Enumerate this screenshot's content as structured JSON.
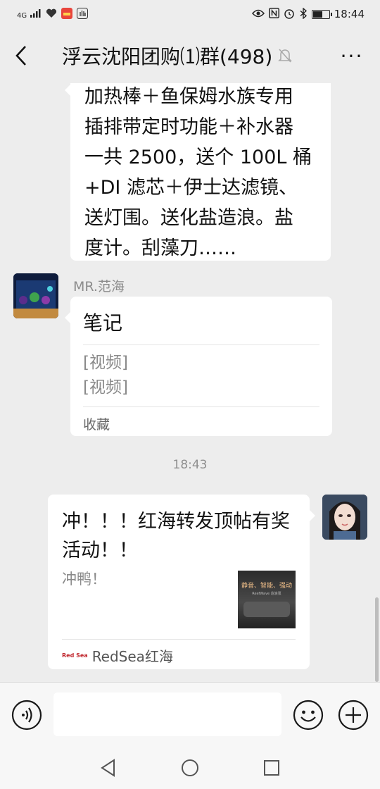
{
  "status_bar": {
    "network": "4G",
    "time": "18:44"
  },
  "header": {
    "title": "浮云沈阳团购⑴群(498)",
    "back_icon": "chevron-left-icon",
    "mute_icon": "bell-off-icon",
    "more_label": "···"
  },
  "messages": {
    "msg1": {
      "lines": [
        "加热棒＋鱼保姆水族专用",
        "插排带定时功能＋补水器",
        "一共 2500，送个 100L 桶",
        "+DI 滤芯＋伊士达滤镜、",
        "送灯围。送化盐造浪。盐",
        "度计。刮藻刀……"
      ]
    },
    "msg2": {
      "sender": "MR.范海",
      "note_title": "笔记",
      "items": [
        "[视频]",
        "[视频]"
      ],
      "footer": "收藏"
    },
    "timestamp": "18:43",
    "msg3": {
      "title": "冲！！！红海转发顶帖有奖活动！！",
      "description": "冲鸭！",
      "thumb_text": "静音、智能、强动",
      "thumb_sub": "ReefWave 造浪泵",
      "source_logo": "Red Sea",
      "source": "RedSea红海"
    }
  },
  "input": {
    "placeholder": ""
  },
  "colors": {
    "background": "#ededed",
    "bubble": "#ffffff",
    "secondary_text": "#8c8c8c"
  }
}
